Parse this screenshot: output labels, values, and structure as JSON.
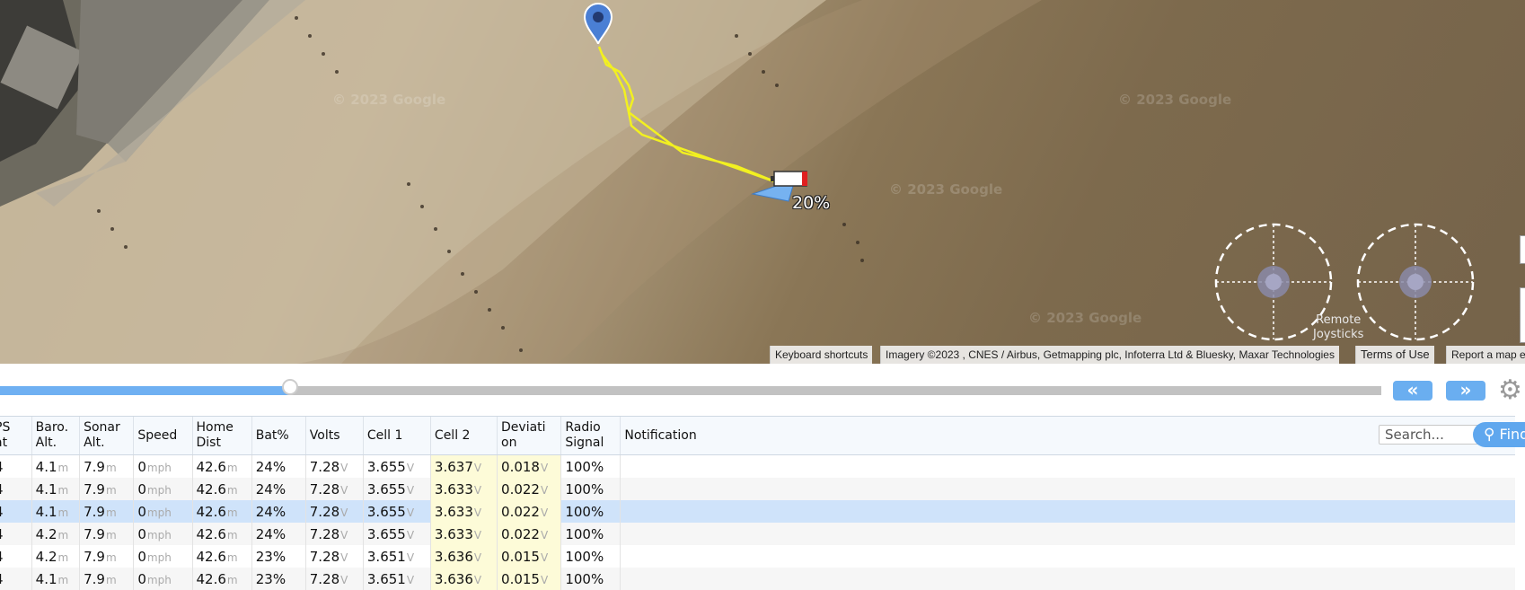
{
  "map": {
    "watermark": "© 2023 Google",
    "battery_percent": "20%",
    "joystick_label_1": "Remote",
    "joystick_label_2": "Joysticks",
    "attribution": {
      "keyboard_shortcuts": "Keyboard shortcuts",
      "imagery": "Imagery ©2023 , CNES / Airbus, Getmapping plc, Infoterra Ltd & Bluesky, Maxar Technologies",
      "terms": "Terms of Use",
      "report": "Report a map e"
    }
  },
  "timeline": {
    "progress_fraction": 0.21,
    "prev_label": "«",
    "next_label": "»",
    "colors": {
      "fill": "#6fb0f2",
      "track": "#c2c2c2",
      "button": "#6aaef0"
    }
  },
  "table": {
    "headers": [
      "PS\nat",
      "Baro.\nAlt.",
      "Sonar\nAlt.",
      "Speed",
      "Home\nDist",
      "Bat%",
      "Volts",
      "Cell 1",
      "Cell 2",
      "Deviati\non",
      "Radio\nSignal",
      "Notification"
    ],
    "units": [
      "",
      "m",
      "m",
      "mph",
      "m",
      "",
      "V",
      "V",
      "V",
      "V",
      "",
      ""
    ],
    "rows": [
      [
        "4",
        "4.1",
        "7.9",
        "0",
        "42.6",
        "24%",
        "7.28",
        "3.655",
        "3.637",
        "0.018",
        "100%",
        ""
      ],
      [
        "4",
        "4.1",
        "7.9",
        "0",
        "42.6",
        "24%",
        "7.28",
        "3.655",
        "3.633",
        "0.022",
        "100%",
        ""
      ],
      [
        "4",
        "4.1",
        "7.9",
        "0",
        "42.6",
        "24%",
        "7.28",
        "3.655",
        "3.633",
        "0.022",
        "100%",
        ""
      ],
      [
        "4",
        "4.2",
        "7.9",
        "0",
        "42.6",
        "24%",
        "7.28",
        "3.655",
        "3.633",
        "0.022",
        "100%",
        ""
      ],
      [
        "4",
        "4.2",
        "7.9",
        "0",
        "42.6",
        "23%",
        "7.28",
        "3.651",
        "3.636",
        "0.015",
        "100%",
        ""
      ],
      [
        "4",
        "4.1",
        "7.9",
        "0",
        "42.6",
        "23%",
        "7.28",
        "3.651",
        "3.636",
        "0.015",
        "100%",
        ""
      ]
    ],
    "selected_row": 2,
    "highlight_columns": [
      8,
      9
    ],
    "search_placeholder": "Search...",
    "find_label": "Find"
  }
}
